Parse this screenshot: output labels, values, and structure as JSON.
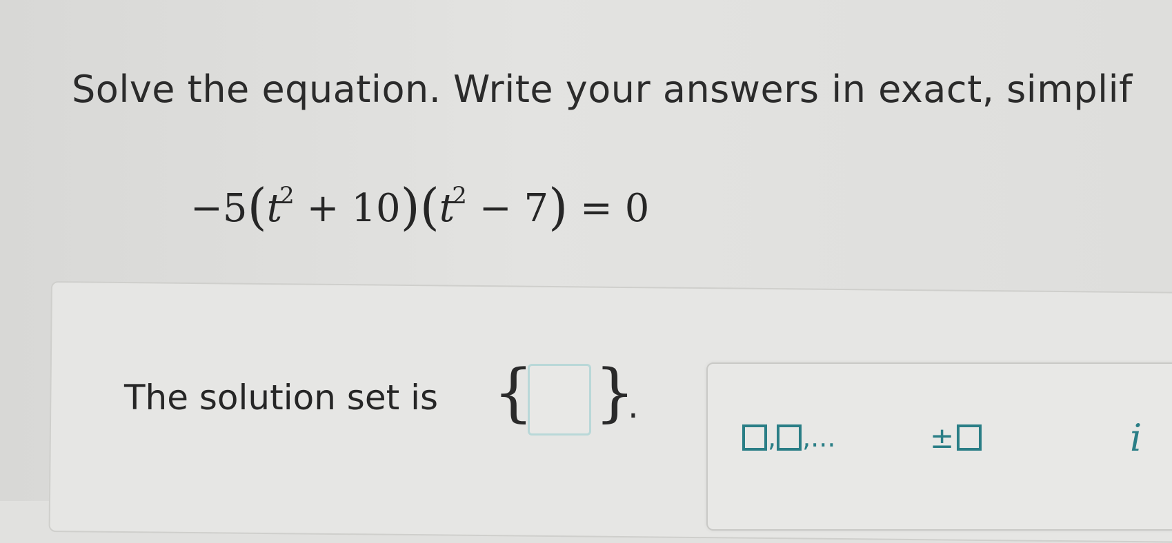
{
  "question": {
    "instructions": "Solve the equation. Write your answers in exact, simplif"
  },
  "equation": {
    "neg_five": "−5",
    "open1": "(",
    "var1": "t",
    "exp1": "2",
    "plus_ten": " + 10",
    "close1": ")",
    "open2": "(",
    "var2": "t",
    "exp2": "2",
    "minus_seven": " − 7",
    "close2": ")",
    "equals_zero": " = 0"
  },
  "answer": {
    "label": "The solution set is",
    "open_brace": "{",
    "close_brace": "}",
    "period": ".",
    "input_value": ""
  },
  "toolbar": {
    "list_separator": ",",
    "list_suffix": ",...",
    "plus_minus": "±",
    "imaginary": "i"
  },
  "colors": {
    "accent": "#2a7e86",
    "input_border": "#b9d8d8"
  }
}
